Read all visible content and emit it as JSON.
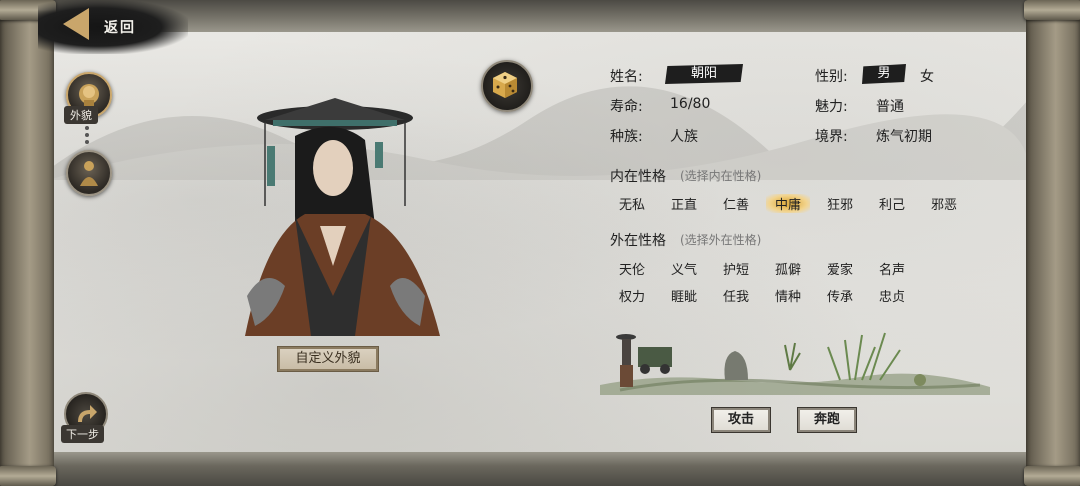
{
  "nav": {
    "back_label": "返回",
    "next_label": "下一步"
  },
  "side": {
    "appearance_label": "外貌"
  },
  "portrait": {
    "custom_label": "自定义外貌"
  },
  "info": {
    "name_label": "姓名:",
    "name_value": "朝阳",
    "gender_label": "性别:",
    "gender_male": "男",
    "gender_female": "女",
    "lifespan_label": "寿命:",
    "lifespan_value": "16/80",
    "charm_label": "魅力:",
    "charm_value": "普通",
    "race_label": "种族:",
    "race_value": "人族",
    "realm_label": "境界:",
    "realm_value": "炼气初期"
  },
  "inner": {
    "title": "内在性格",
    "hint": "(选择内在性格)",
    "traits": [
      "无私",
      "正直",
      "仁善",
      "中庸",
      "狂邪",
      "利己",
      "邪恶"
    ],
    "selected": "中庸"
  },
  "outer": {
    "title": "外在性格",
    "hint": "(选择外在性格)",
    "traits_row1": [
      "天伦",
      "义气",
      "护短",
      "孤僻",
      "爱家",
      "名声"
    ],
    "traits_row2": [
      "权力",
      "睚眦",
      "任我",
      "情种",
      "传承",
      "忠贞"
    ]
  },
  "actions": {
    "attack_label": "攻击",
    "flee_label": "奔跑"
  },
  "colors": {
    "accent_gold": "#c9a66b",
    "selected_gold": "#e1b24c",
    "ink": "#1e1e1e"
  }
}
